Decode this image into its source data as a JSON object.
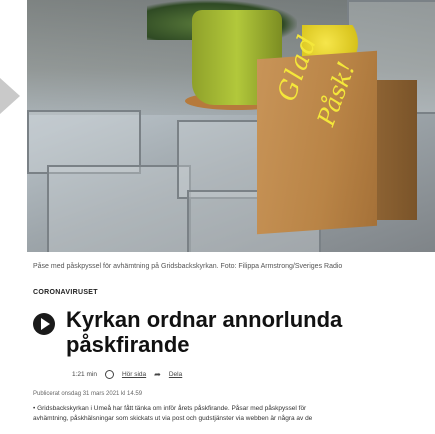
{
  "photo": {
    "bag_text_line1": "Glad",
    "bag_text_line2": "Påsk!"
  },
  "caption": "Påse med påskpyssel för avhämtning på Gridsbackskyrkan. Foto: Filippa Armstrong/Sveriges Radio",
  "category": "CORONAVIRUSET",
  "headline": "Kyrkan ordnar annorlunda påskfirande",
  "meta": {
    "duration": "1:21 min",
    "listen_label": "Hör sida",
    "share_label": "Dela"
  },
  "published": "Publicerat onsdag 31 mars 2021 kl 14.59",
  "body_lines": [
    "• Gridsbackskyrkan i Umeå har fått tänka om inför årets påskfirande. Påsar med påskpyssel för",
    "avhämtning, påskhälsningar som skickats ut via post och gudstjänster via webben är några av de"
  ]
}
